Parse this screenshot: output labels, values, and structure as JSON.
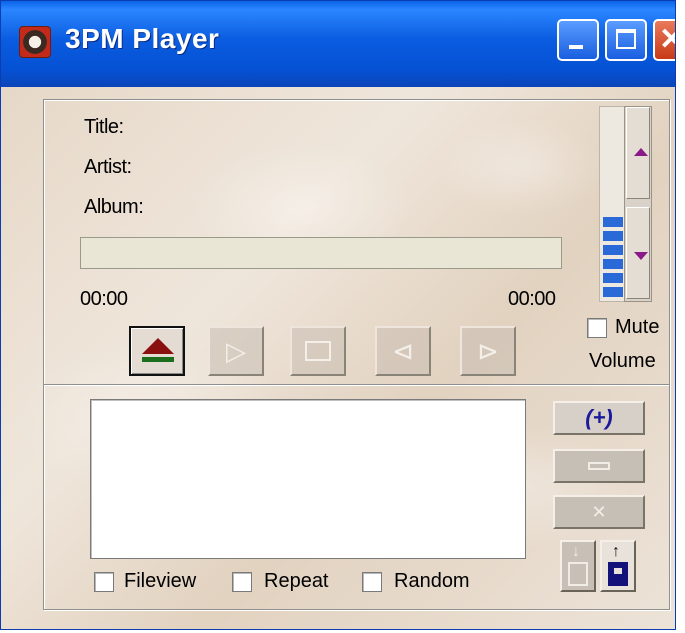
{
  "window": {
    "title": "3PM Player",
    "minimize_label": "Minimize",
    "maximize_label": "Maximize",
    "close_glyph": "✕"
  },
  "info": {
    "title_label": "Title:",
    "artist_label": "Artist:",
    "album_label": "Album:"
  },
  "progress": {
    "elapsed": "00:00",
    "total": "00:00",
    "fraction": 0
  },
  "transport": {
    "eject": "Eject",
    "play_glyph": "▷",
    "next_glyph": "⊳",
    "prev_glyph": "⊲"
  },
  "volume": {
    "level_fraction": 0.55,
    "mute_label": "Mute",
    "mute_checked": false,
    "volume_label": "Volume",
    "bar_color": "#2a6ad8",
    "arrow_color": "#8a1a8a"
  },
  "playlist": {
    "items": [],
    "add_label": "(+)",
    "clear_glyph": "✕",
    "options": [
      {
        "label": "Fileview",
        "checked": false
      },
      {
        "label": "Repeat",
        "checked": false
      },
      {
        "label": "Random",
        "checked": false
      }
    ]
  },
  "colors": {
    "titlebar": "#0651d4",
    "eject_up": "#8a1010",
    "eject_bar": "#1c6e1c",
    "save_icon": "#12127a"
  }
}
